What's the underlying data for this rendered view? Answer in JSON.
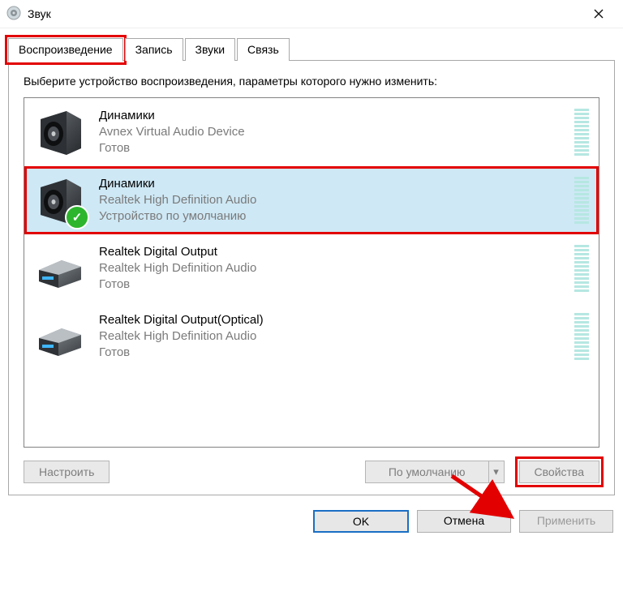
{
  "window": {
    "title": "Звук"
  },
  "tabs": [
    {
      "label": "Воспроизведение",
      "active": true
    },
    {
      "label": "Запись",
      "active": false
    },
    {
      "label": "Звуки",
      "active": false
    },
    {
      "label": "Связь",
      "active": false
    }
  ],
  "instruction": "Выберите устройство воспроизведения, параметры которого нужно изменить:",
  "devices": [
    {
      "name": "Динамики",
      "subtitle": "Avnex Virtual Audio Device",
      "status": "Готов",
      "icon": "speaker",
      "default": false,
      "selected": false
    },
    {
      "name": "Динамики",
      "subtitle": "Realtek High Definition Audio",
      "status": "Устройство по умолчанию",
      "icon": "speaker",
      "default": true,
      "selected": true
    },
    {
      "name": "Realtek Digital Output",
      "subtitle": "Realtek High Definition Audio",
      "status": "Готов",
      "icon": "optical",
      "default": false,
      "selected": false
    },
    {
      "name": "Realtek Digital Output(Optical)",
      "subtitle": "Realtek High Definition Audio",
      "status": "Готов",
      "icon": "optical",
      "default": false,
      "selected": false
    }
  ],
  "buttons": {
    "configure": "Настроить",
    "set_default": "По умолчанию",
    "properties": "Свойства",
    "ok": "OK",
    "cancel": "Отмена",
    "apply": "Применить"
  }
}
